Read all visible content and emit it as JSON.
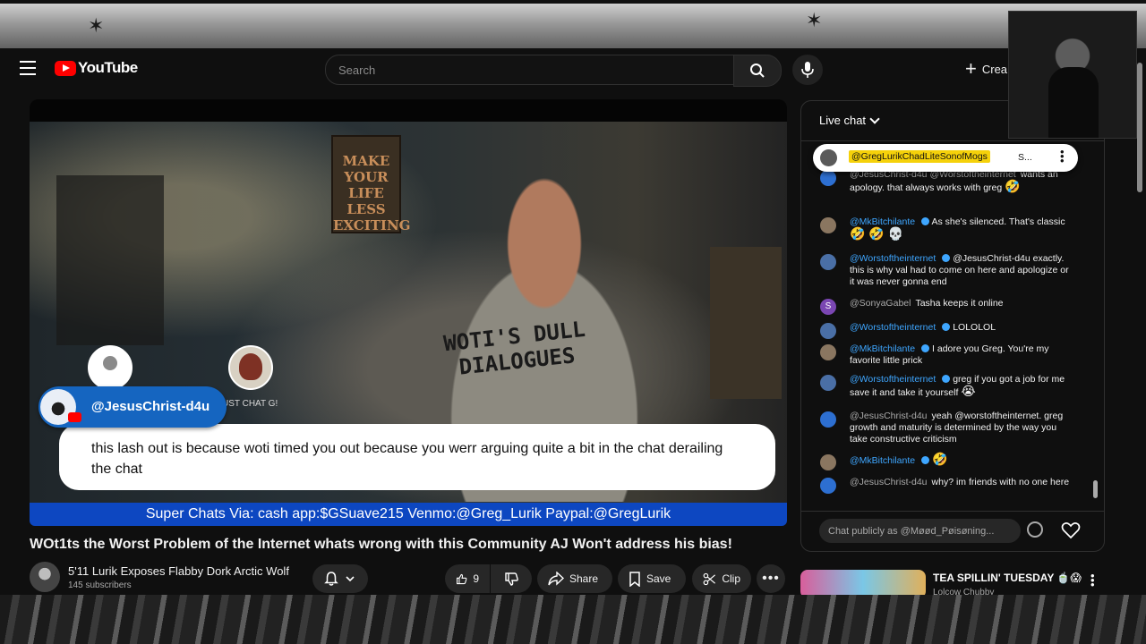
{
  "header": {
    "logo_text": "YouTube",
    "search_placeholder": "Search",
    "create_label": "Crea"
  },
  "player": {
    "poster_text": "MAKE YOUR LIFE LESS EXCITING",
    "shirt_text": "WOTI'S DULL DIALOGUES",
    "overlay_small": "UST CHAT G!",
    "chat_card": {
      "author": "@JesusChrist-d4u",
      "message": "this lash out is because woti timed you out because you werr arguing quite a bit in the chat derailing the chat"
    },
    "super_chat_banner": "Super Chats Via: cash app:$GSuave215 Venmo:@Greg_Lurik Paypal:@GregLurik"
  },
  "video": {
    "title": "WOt1ts the Worst Problem of the Internet whats wrong with this Community AJ Won't address his bias!",
    "channel_name": "5'11 Lurik Exposes Flabby Dork Arctic Wolf",
    "subscribers": "145 subscribers",
    "like_count": "9",
    "share_label": "Share",
    "save_label": "Save",
    "clip_label": "Clip"
  },
  "chat": {
    "title": "Live chat",
    "pinned": {
      "author": "@GregLurikChadLiteSonofMogs",
      "preview": "S..."
    },
    "messages": [
      {
        "author": "@JesusChrist-d4u @Worstoftheinternet",
        "text": "wants an apology. that always works with greg",
        "emoji": "🤣"
      },
      {
        "author": "@MkBitchilante",
        "text": "As she's silenced. That's classic",
        "emoji": "🤣 🤣 💀"
      },
      {
        "author": "@Worstoftheinternet",
        "text": "@JesusChrist-d4u exactly. this is why val had to come on here and apologize or it was never gonna end",
        "emoji": ""
      },
      {
        "author": "@SonyaGabel",
        "text": "Tasha keeps it online",
        "emoji": ""
      },
      {
        "author": "@Worstoftheinternet",
        "text": "LOLOLOL",
        "emoji": ""
      },
      {
        "author": "@MkBitchilante",
        "text": "I adore you Greg. You're my favorite little prick",
        "emoji": ""
      },
      {
        "author": "@Worstoftheinternet",
        "text": "greg if you got a job for me save it and take it yourself",
        "emoji": "😭"
      },
      {
        "author": "@JesusChrist-d4u",
        "text": "yeah @worstoftheinternet. greg growth and maturity is determined by the way you take constructive criticism",
        "emoji": ""
      },
      {
        "author": "@MkBitchilante",
        "text": "",
        "emoji": "🤣"
      },
      {
        "author": "@JesusChrist-d4u",
        "text": "why? im friends with no one here",
        "emoji": ""
      }
    ],
    "input_placeholder": "Chat publicly as @Møød_Pøisøning..."
  },
  "suggestion": {
    "title": "TEA SPILLIN' TUESDAY 🍵😱",
    "channel": "Lolcow Chubby"
  },
  "icons": {
    "menu": "menu-icon",
    "search": "search-icon",
    "mic": "mic-icon",
    "bell": "bell-icon",
    "like": "thumbs-up-icon",
    "dislike": "thumbs-down-icon",
    "share": "share-icon",
    "save": "bookmark-icon",
    "clip": "scissors-icon",
    "emoji": "smiley-icon",
    "heart": "heart-icon"
  },
  "colors": {
    "brand_red": "#ff0000",
    "super_chat_blue": "#0d47c1",
    "link_blue": "#3ea6ff",
    "pinned_highlight": "#f5d10a"
  }
}
